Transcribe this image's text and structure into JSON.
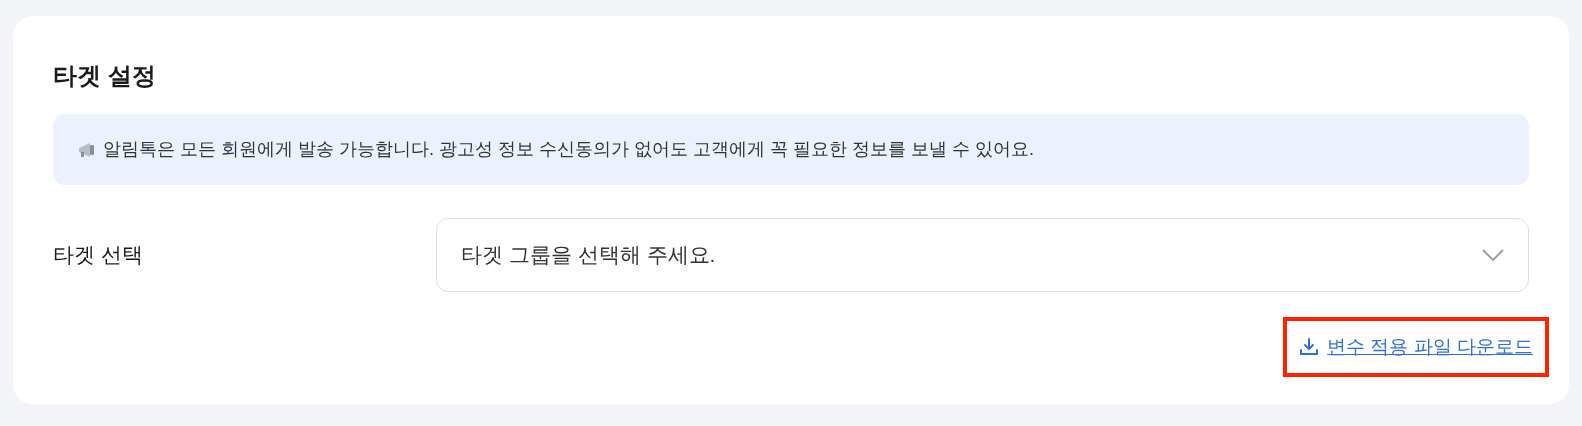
{
  "section": {
    "title": "타겟 설정"
  },
  "notice": {
    "text": "알림톡은 모든 회원에게 발송 가능합니다. 광고성 정보 수신동의가 없어도 고객에게 꼭 필요한 정보를 보낼 수 있어요."
  },
  "target_select": {
    "label": "타겟 선택",
    "placeholder": "타겟 그룹을 선택해 주세요."
  },
  "download_link": {
    "text": "변수 적용 파일 다운로드",
    "highlighted": true
  }
}
